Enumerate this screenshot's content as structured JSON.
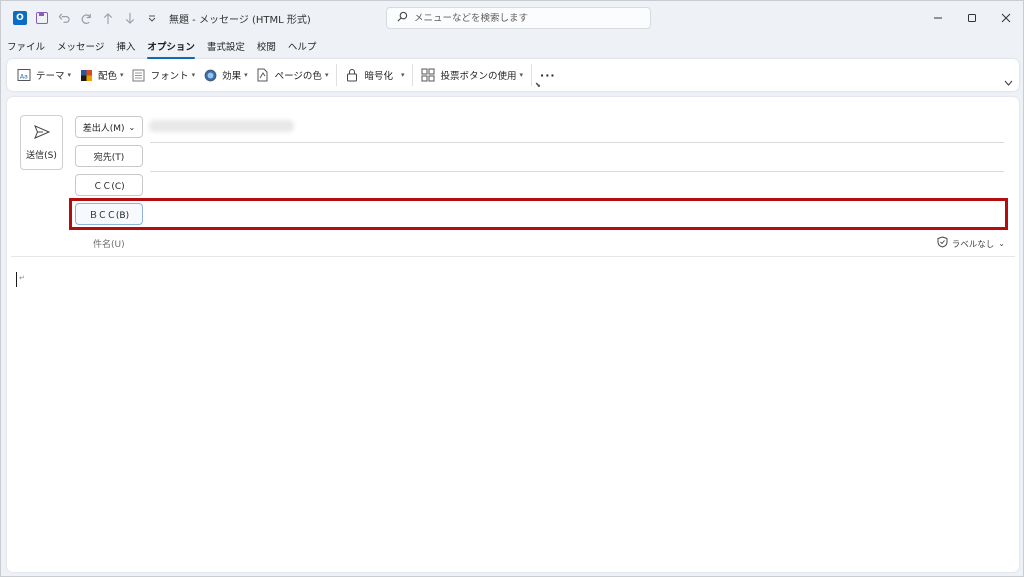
{
  "window": {
    "title": "無題  -  メッセージ (HTML 形式)",
    "app_icon": "outlook-icon",
    "quick_access": [
      "save-icon",
      "undo-icon",
      "redo-icon",
      "up-arrow-icon",
      "down-arrow-icon",
      "customize-icon"
    ],
    "controls": [
      "minimize-icon",
      "maximize-icon",
      "close-icon"
    ]
  },
  "search": {
    "placeholder": "メニューなどを検索します"
  },
  "menu": {
    "tabs": [
      {
        "label": "ファイル"
      },
      {
        "label": "メッセージ"
      },
      {
        "label": "挿入"
      },
      {
        "label": "オプション",
        "active": true
      },
      {
        "label": "書式設定"
      },
      {
        "label": "校閲"
      },
      {
        "label": "ヘルプ"
      }
    ]
  },
  "ribbon": {
    "theme": "テーマ",
    "colors": "配色",
    "font": "フォント",
    "effects": "効果",
    "page_color": "ページの色",
    "encrypt": "暗号化",
    "voting": "投票ボタンの使用",
    "more": "···"
  },
  "compose": {
    "send": "送信(S)",
    "from": "差出人(M)",
    "to": "宛先(T)",
    "cc": "ＣＣ(C)",
    "bcc": "ＢＣＣ(B)",
    "subject": "件名(U)",
    "sensitivity": "ラベルなし",
    "para_mark": "↵"
  },
  "colors": {
    "accent": "#0f6cbd",
    "highlight": "#b40d10"
  }
}
